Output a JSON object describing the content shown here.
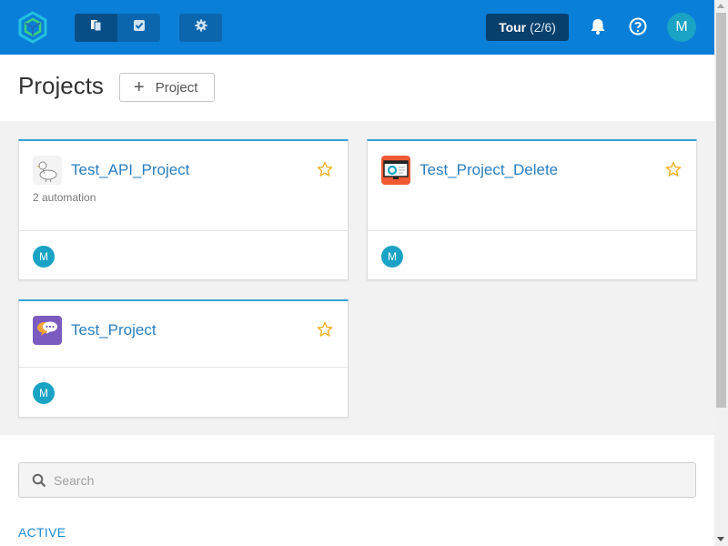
{
  "topbar": {
    "tour_label": "Tour",
    "tour_count": "(2/6)",
    "avatar_initial": "M",
    "colors": {
      "bar": "#0a7fd8",
      "tour": "#083f6b",
      "avatar": "#1aa3c4"
    }
  },
  "header": {
    "title": "Projects",
    "add_project_label": "Project"
  },
  "projects": [
    {
      "name": "Test_API_Project",
      "subtitle": "2 automation",
      "icon": "pigeon-icon",
      "starred": false,
      "member_initial": "M"
    },
    {
      "name": "Test_Project_Delete",
      "subtitle": "",
      "icon": "monitor-chart-icon",
      "starred": false,
      "member_initial": "M"
    },
    {
      "name": "Test_Project",
      "subtitle": "",
      "icon": "chat-bubbles-icon",
      "starred": false,
      "member_initial": "M"
    }
  ],
  "search": {
    "placeholder": "Search",
    "value": ""
  },
  "section": {
    "label": "ACTIVE"
  }
}
